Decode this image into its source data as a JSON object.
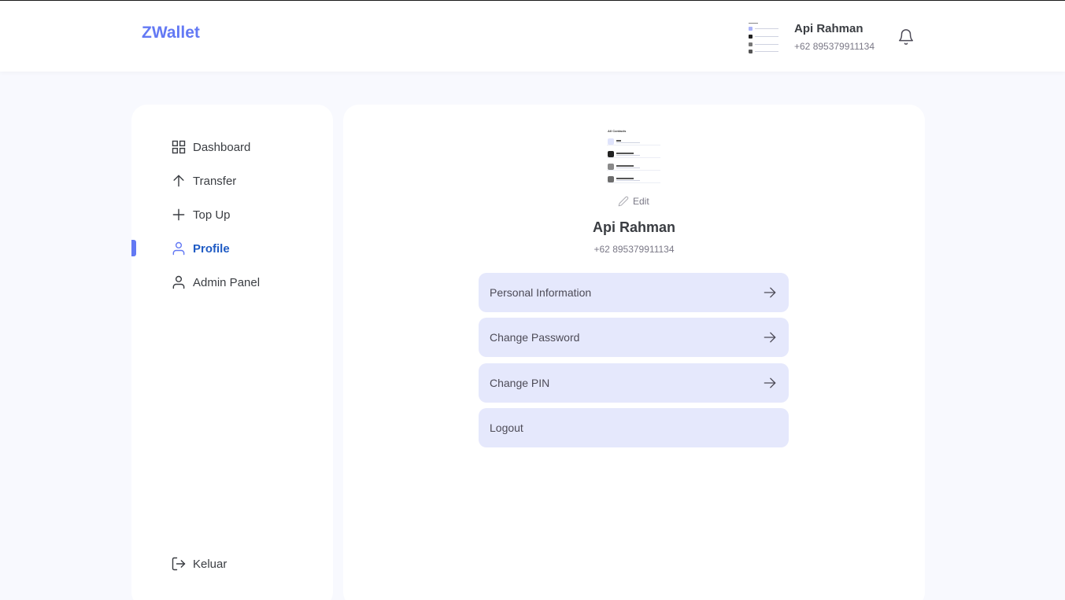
{
  "app": {
    "logo": "ZWallet"
  },
  "header": {
    "user_name": "Api Rahman",
    "user_phone": "+62 895379911134",
    "avatar_icon": "avatar-thumbnail",
    "notification_icon": "bell-icon"
  },
  "sidebar": {
    "items": [
      {
        "label": "Dashboard",
        "icon": "grid-icon",
        "active": false
      },
      {
        "label": "Transfer",
        "icon": "arrow-up-icon",
        "active": false
      },
      {
        "label": "Top Up",
        "icon": "plus-icon",
        "active": false
      },
      {
        "label": "Profile",
        "icon": "user-icon",
        "active": true
      },
      {
        "label": "Admin Panel",
        "icon": "user-icon",
        "active": false
      }
    ],
    "logout": {
      "label": "Keluar",
      "icon": "log-out-icon"
    }
  },
  "profile": {
    "thumbnail_title": "All Contacts",
    "edit_label": "Edit",
    "name": "Api Rahman",
    "phone": "+62 895379911134",
    "menu": [
      {
        "label": "Personal Information",
        "has_arrow": true
      },
      {
        "label": "Change Password",
        "has_arrow": true
      },
      {
        "label": "Change PIN",
        "has_arrow": true
      },
      {
        "label": "Logout",
        "has_arrow": false
      }
    ]
  },
  "colors": {
    "accent": "#6379f4",
    "active_text": "#1f5bc4",
    "menu_bg": "#e5e8fc",
    "page_bg": "#f8f9fe"
  }
}
